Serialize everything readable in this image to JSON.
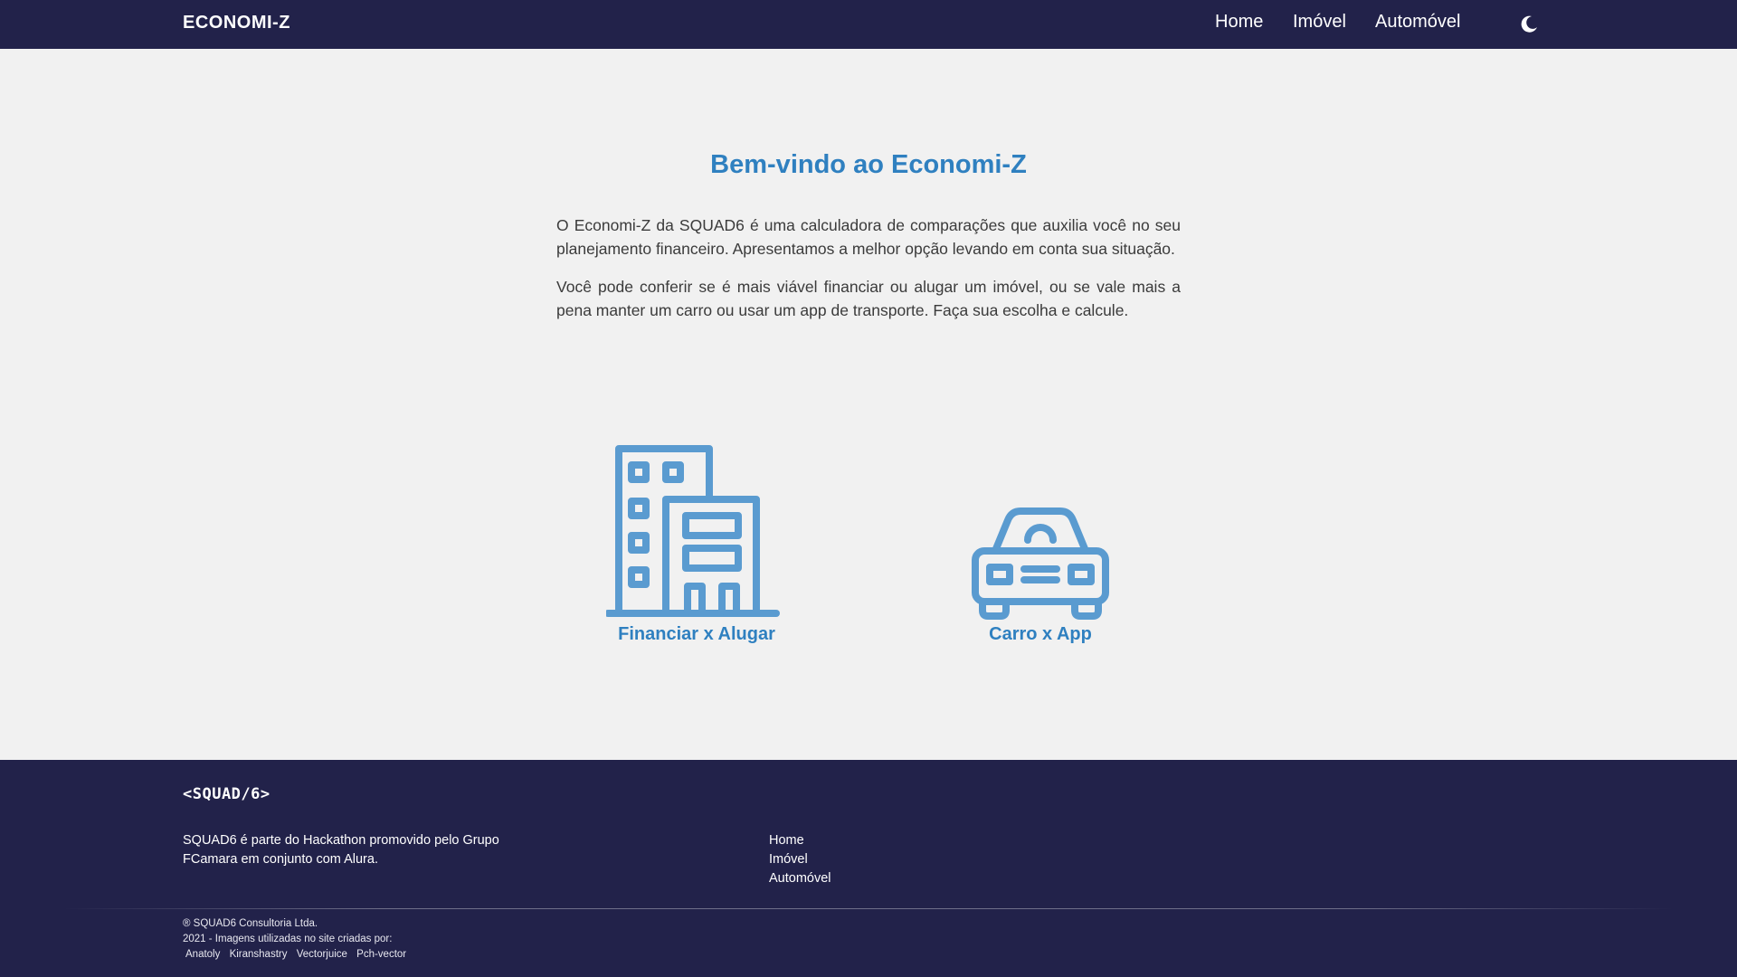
{
  "header": {
    "brand": "ECONOMI-Z",
    "nav": [
      {
        "label": "Home"
      },
      {
        "label": "Imóvel"
      },
      {
        "label": "Automóvel"
      }
    ],
    "theme_toggle_icon": "moon-icon"
  },
  "main": {
    "title": "Bem-vindo ao Economi-Z",
    "paragraphs": [
      "O Economi-Z da SQUAD6 é uma calculadora de comparações que auxilia você no seu planejamento financeiro. Apresentamos a melhor opção levando em conta sua situação.",
      "Você pode conferir se é mais viável financiar ou alugar um imóvel, ou se vale mais a pena manter um carro ou usar um app de transporte. Faça sua escolha e calcule."
    ],
    "cards": [
      {
        "label": "Financiar x Alugar",
        "icon": "building-icon"
      },
      {
        "label": "Carro x App",
        "icon": "car-icon"
      }
    ]
  },
  "footer": {
    "logo_text": "<SQUAD/6>",
    "about": "SQUAD6 é parte do Hackathon promovido pelo Grupo FCamara em conjunto com Alura.",
    "links": [
      {
        "label": "Home"
      },
      {
        "label": "Imóvel"
      },
      {
        "label": "Automóvel"
      }
    ],
    "copyright": "® SQUAD6 Consultoria Ltda.",
    "images_note": "2021 - Imagens utilizadas no site criadas por:",
    "credits": [
      "Anatoly",
      "Kiranshastry",
      "Vectorjuice",
      "Pch-vector"
    ]
  },
  "colors": {
    "navy": "#22224a",
    "accent_blue": "#2f80c0",
    "icon_blue": "#5a9bd0",
    "background": "#f1f1f1"
  }
}
